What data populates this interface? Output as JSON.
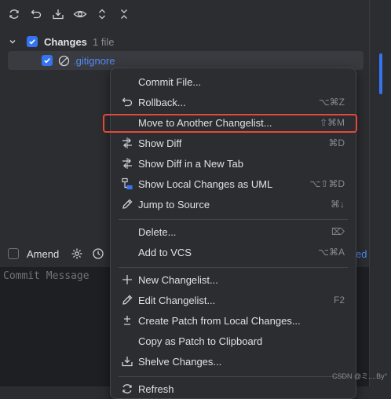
{
  "toolbar": {
    "icons": [
      "refresh-icon",
      "rollback-icon",
      "shelve-icon",
      "eye-icon",
      "expand-icon",
      "collapse-icon"
    ]
  },
  "tree": {
    "changes_label": "Changes",
    "changes_count": "1 file",
    "file_name": ".gitignore"
  },
  "amend": {
    "label": "Amend",
    "cut_text": "ed"
  },
  "commit": {
    "placeholder": "Commit Message"
  },
  "menu": {
    "items": [
      {
        "label": "Commit File...",
        "shortcut": ""
      },
      {
        "label": "Rollback...",
        "shortcut": "⌥⌘Z"
      },
      {
        "label": "Move to Another Changelist...",
        "shortcut": "⇧⌘M"
      },
      {
        "label": "Show Diff",
        "shortcut": "⌘D"
      },
      {
        "label": "Show Diff in a New Tab",
        "shortcut": ""
      },
      {
        "label": "Show Local Changes as UML",
        "shortcut": "⌥⇧⌘D"
      },
      {
        "label": "Jump to Source",
        "shortcut": "⌘↓"
      },
      {
        "label": "Delete...",
        "shortcut": "⌦"
      },
      {
        "label": "Add to VCS",
        "shortcut": "⌥⌘A"
      },
      {
        "label": "New Changelist...",
        "shortcut": ""
      },
      {
        "label": "Edit Changelist...",
        "shortcut": "F2"
      },
      {
        "label": "Create Patch from Local Changes...",
        "shortcut": ""
      },
      {
        "label": "Copy as Patch to Clipboard",
        "shortcut": ""
      },
      {
        "label": "Shelve Changes...",
        "shortcut": ""
      },
      {
        "label": "Refresh",
        "shortcut": ""
      }
    ]
  },
  "watermark": "CSDN @ミ....By°",
  "colors": {
    "accent": "#3574f0",
    "highlight": "#e5483a",
    "background": "#2b2d30"
  }
}
